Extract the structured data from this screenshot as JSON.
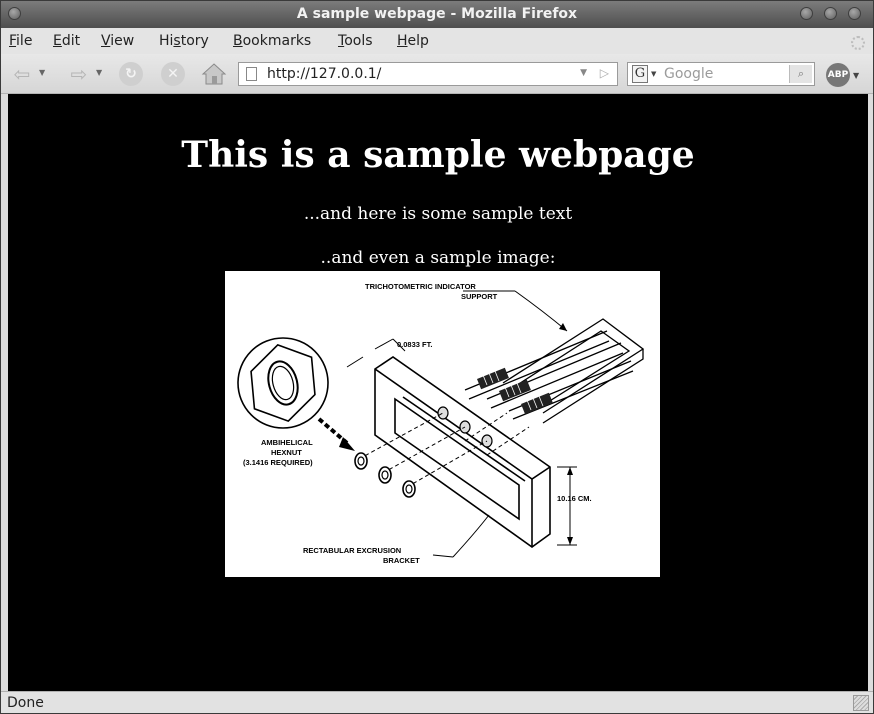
{
  "window": {
    "title": "A sample webpage - Mozilla Firefox"
  },
  "menu": [
    {
      "label": "File",
      "mnemonic": "F",
      "rest": "ile"
    },
    {
      "label": "Edit",
      "mnemonic": "E",
      "rest": "dit"
    },
    {
      "label": "View",
      "mnemonic": "V",
      "rest": "iew"
    },
    {
      "label": "History",
      "pre": "Hi",
      "mnemonic": "s",
      "rest": "tory"
    },
    {
      "label": "Bookmarks",
      "mnemonic": "B",
      "rest": "ookmarks"
    },
    {
      "label": "Tools",
      "mnemonic": "T",
      "rest": "ools"
    },
    {
      "label": "Help",
      "mnemonic": "H",
      "rest": "elp"
    }
  ],
  "toolbar": {
    "back_icon": "back-arrow-icon",
    "forward_icon": "forward-arrow-icon",
    "reload_icon": "reload-icon",
    "stop_icon": "stop-icon",
    "home_icon": "home-icon",
    "url": "http://127.0.0.1/",
    "search_engine_letter": "G",
    "search_placeholder": "Google",
    "adblock_label": "ABP"
  },
  "page": {
    "heading": "This is a sample webpage",
    "text1": "...and here is some sample text",
    "text2": "..and even a sample image:",
    "image": {
      "labels": {
        "indicator_line1": "TRICHOTOMETRIC INDICATOR",
        "indicator_line2": "SUPPORT",
        "dimension_ft": "0.0833 FT.",
        "hexnut_line1": "AMBIHELICAL",
        "hexnut_line2": "HEXNUT",
        "hexnut_line3": "(3.1416 REQUIRED)",
        "dimension_cm": "10.16 CM.",
        "bracket_line1": "RECTABULAR EXCRUSION",
        "bracket_line2": "BRACKET"
      }
    }
  },
  "status": {
    "text": "Done"
  }
}
